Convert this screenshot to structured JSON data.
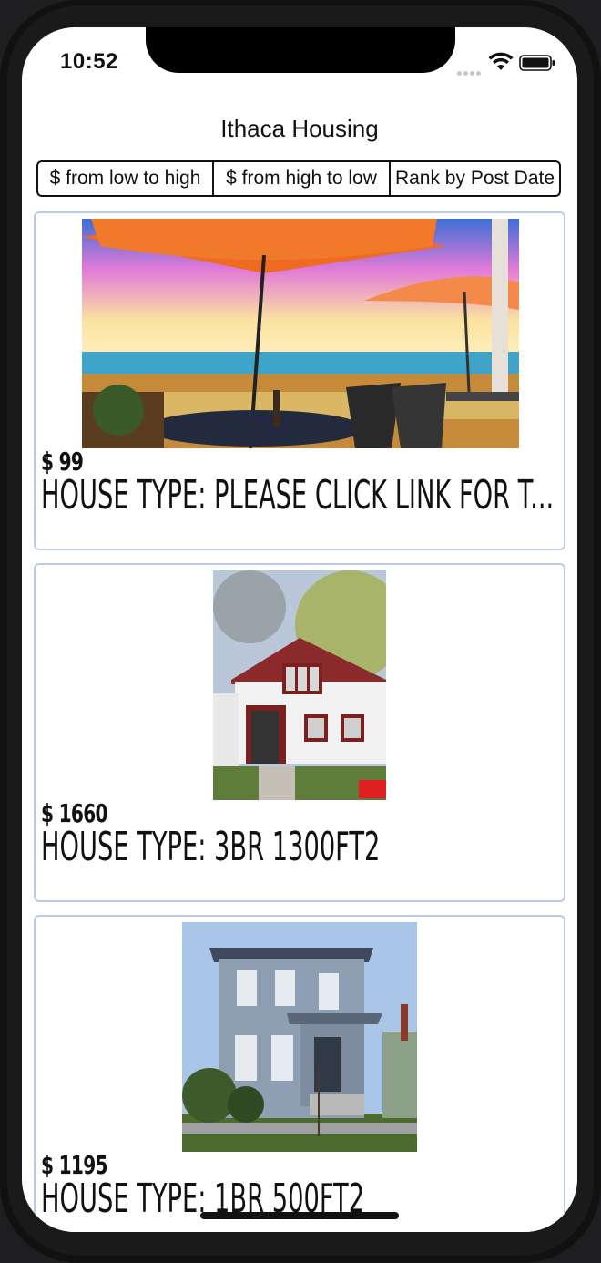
{
  "status_bar": {
    "time": "10:52"
  },
  "nav": {
    "title": "Ithaca Housing"
  },
  "sort_options": [
    "$ from low to high",
    "$ from high to low",
    "Rank by Post Date"
  ],
  "listings": [
    {
      "price": "$ 99",
      "house_type": "HOUSE TYPE: PLEASE CLICK LINK FOR T..."
    },
    {
      "price": "$ 1660",
      "house_type": "HOUSE TYPE: 3BR 1300FT2"
    },
    {
      "price": "$ 1195",
      "house_type": "HOUSE TYPE: 1BR 500FT2"
    }
  ],
  "icons": [
    "signal-icon",
    "wifi-icon",
    "battery-icon"
  ],
  "colors": {
    "card_border": "#b9cbe8",
    "text": "#111111"
  }
}
